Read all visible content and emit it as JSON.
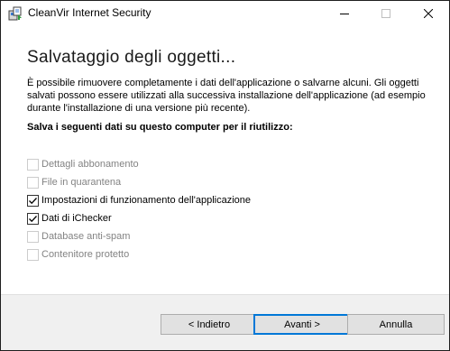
{
  "window": {
    "title": "CleanVir Internet Security",
    "app_icon": "setup-installer-icon",
    "controls": {
      "minimize_icon": "minimize-icon",
      "maximize_icon": "maximize-icon",
      "close_icon": "close-icon"
    }
  },
  "page": {
    "heading": "Salvataggio degli oggetti...",
    "description": "È possibile rimuovere completamente i dati dell'applicazione o salvarne alcuni. Gli oggetti salvati possono essere utilizzati alla successiva installazione dell'applicazione (ad esempio durante l'installazione di una versione più recente).",
    "subheading": "Salva i seguenti dati su questo computer per il riutilizzo:",
    "options": [
      {
        "label": "Dettagli abbonamento",
        "checked": false,
        "enabled": false
      },
      {
        "label": "File in quarantena",
        "checked": false,
        "enabled": false
      },
      {
        "label": "Impostazioni di funzionamento dell'applicazione",
        "checked": true,
        "enabled": true
      },
      {
        "label": "Dati di iChecker",
        "checked": true,
        "enabled": true
      },
      {
        "label": "Database anti-spam",
        "checked": false,
        "enabled": false
      },
      {
        "label": "Contenitore protetto",
        "checked": false,
        "enabled": false
      }
    ]
  },
  "footer": {
    "back_label": "< Indietro",
    "next_label": "Avanti >",
    "cancel_label": "Annulla"
  },
  "colors": {
    "accent": "#0078d7",
    "button_face": "#e1e1e1",
    "footer_bg": "#f0f0f0",
    "disabled_text": "#838383"
  }
}
